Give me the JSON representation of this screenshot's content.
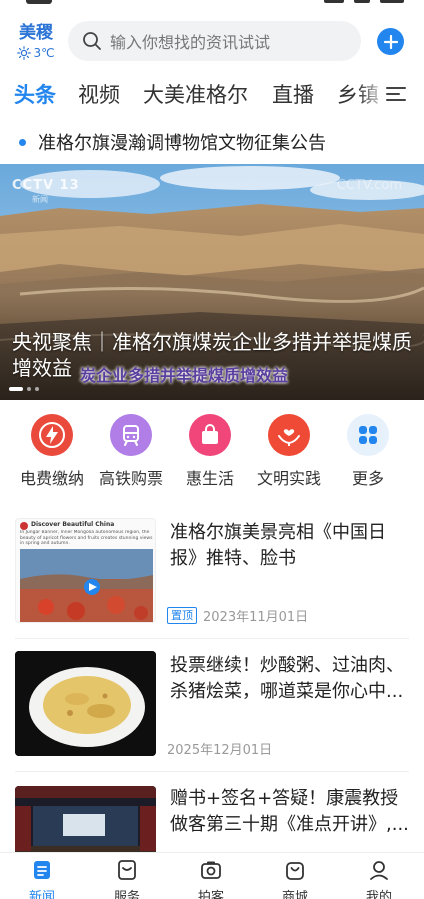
{
  "header": {
    "city": "美稷",
    "temperature": "3℃",
    "search_placeholder": "输入你想找的资讯试试",
    "icons": {
      "weather": "sun-icon",
      "search": "search-icon",
      "add": "plus-icon"
    }
  },
  "tabs": [
    {
      "label": "头条",
      "active": true
    },
    {
      "label": "视频",
      "active": false
    },
    {
      "label": "大美准格尔",
      "active": false
    },
    {
      "label": "直播",
      "active": false
    },
    {
      "label": "乡镇",
      "active": false
    }
  ],
  "menu_icon": "menu-icon",
  "announcement": {
    "text": "准格尔旗漫瀚调博物馆文物征集公告"
  },
  "banner": {
    "logo_left": "CCTV 13",
    "logo_left_sub": "新闻",
    "logo_right": "CCTV.com",
    "title": "央视聚焦｜准格尔旗煤炭企业多措并举提煤质增效益",
    "caption": "炭企业多措并举提煤质增效益",
    "slide_count": 3,
    "active_slide": 0
  },
  "services": [
    {
      "label": "电费缴纳",
      "icon": "lightning-icon",
      "color": "#ea4a3c"
    },
    {
      "label": "高铁购票",
      "icon": "train-icon",
      "color": "#b07ee6"
    },
    {
      "label": "惠生活",
      "icon": "shopping-bag-icon",
      "color": "#f0467a"
    },
    {
      "label": "文明实践",
      "icon": "hands-heart-icon",
      "color": "#ef4a36"
    },
    {
      "label": "更多",
      "icon": "grid-more-icon",
      "color": "#2286ee"
    }
  ],
  "news": [
    {
      "headline": "准格尔旗美景亮相《中国日报》推特、脸书",
      "pinned": true,
      "pin_label": "置顶",
      "date": "2023年11月01日",
      "thumb_heading": "Discover Beautiful China",
      "thumb_text": "In Jungar Banner, Inner Mongolia autonomous region, the beauty of apricot flowers and fruits creates stunning views in spring and autumn."
    },
    {
      "headline": "投票继续！炒酸粥、过油肉、杀猪烩菜，哪道菜是你心中...",
      "pinned": false,
      "date": "2025年12月01日"
    },
    {
      "headline": "赠书+签名+答疑！康震教授做客第三十期《准点开讲》,...",
      "pinned": false,
      "date": ""
    }
  ],
  "bottom_nav": [
    {
      "label": "新闻",
      "icon": "news-icon",
      "active": true
    },
    {
      "label": "服务",
      "icon": "service-icon",
      "active": false
    },
    {
      "label": "拍客",
      "icon": "camera-icon",
      "active": false
    },
    {
      "label": "商城",
      "icon": "shop-bag-icon",
      "active": false
    },
    {
      "label": "我的",
      "icon": "user-icon",
      "active": false
    }
  ],
  "colors": {
    "accent": "#2286ee",
    "weather": "#2b74d6"
  }
}
